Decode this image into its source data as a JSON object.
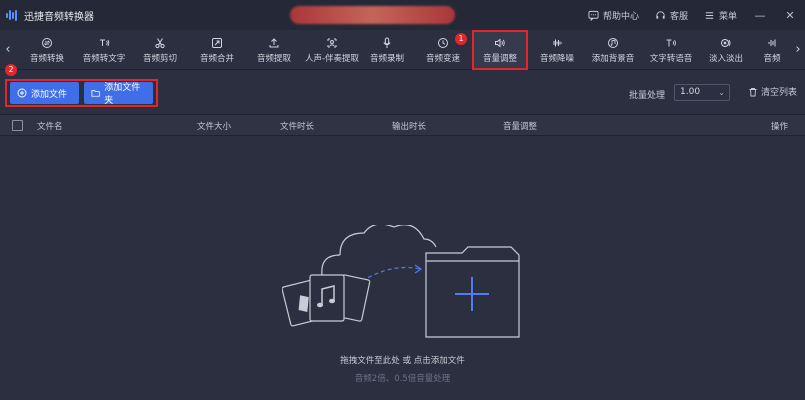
{
  "app": {
    "title": "迅捷音频转换器"
  },
  "titlebar": {
    "help_label": "帮助中心",
    "service_label": "客服",
    "menu_label": "菜单",
    "min_glyph": "—",
    "close_glyph": "✕"
  },
  "toolbar": {
    "prev_glyph": "‹",
    "next_glyph": "›",
    "tools": [
      {
        "label": "音频转换",
        "icon": "convert-icon"
      },
      {
        "label": "音频转文字",
        "icon": "speech-text-icon"
      },
      {
        "label": "音频剪切",
        "icon": "scissors-icon"
      },
      {
        "label": "音频合并",
        "icon": "merge-icon"
      },
      {
        "label": "音频提取",
        "icon": "extract-icon"
      },
      {
        "label": "人声-伴奏提取",
        "icon": "voice-separate-icon"
      },
      {
        "label": "音频录制",
        "icon": "microphone-icon"
      },
      {
        "label": "音频变速",
        "icon": "speed-icon"
      },
      {
        "label": "音量调整",
        "icon": "volume-icon"
      },
      {
        "label": "音频降噪",
        "icon": "denoise-icon"
      },
      {
        "label": "添加背景音",
        "icon": "bg-music-icon"
      },
      {
        "label": "文字转语音",
        "icon": "text-speech-icon"
      },
      {
        "label": "淡入淡出",
        "icon": "fade-icon"
      },
      {
        "label": "音频",
        "icon": "waveform-icon"
      }
    ],
    "badge_1": "1",
    "badge_2": "2"
  },
  "actions": {
    "add_file": "添加文件",
    "add_folder": "添加文件夹",
    "batch_label": "批量处理",
    "batch_value": "1.00",
    "clear_list": "清空列表"
  },
  "table": {
    "columns": [
      "文件名",
      "文件大小",
      "文件时长",
      "输出时长",
      "音量调整",
      "操作"
    ]
  },
  "empty_state": {
    "main_text": "拖拽文件至此处 或 点击添加文件",
    "sub_text": "音频2倍、0.5倍音量处理"
  },
  "colors": {
    "accent": "#3f6ee8",
    "highlight": "#e2262a",
    "background": "#2b2f3f"
  }
}
